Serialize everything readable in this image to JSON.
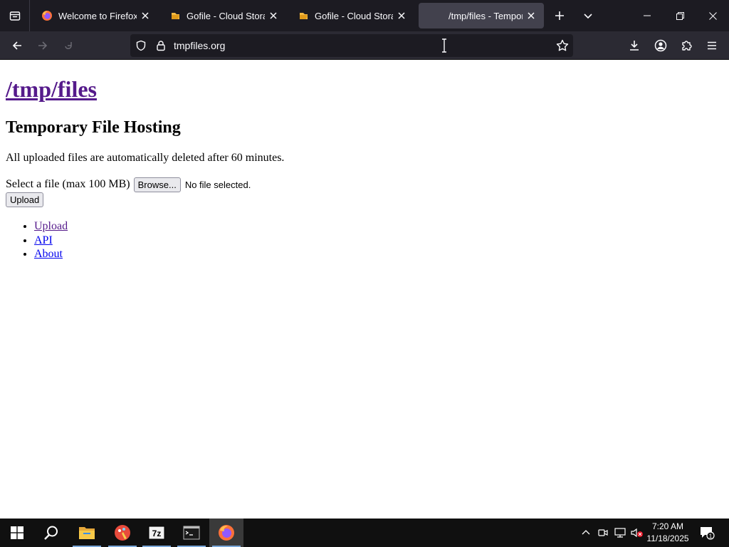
{
  "browser": {
    "tabs": [
      {
        "title": "Welcome to Firefox",
        "icon": "firefox-icon",
        "active": false
      },
      {
        "title": "Gofile - Cloud Storage Made Simple",
        "icon": "gofile-icon",
        "active": false
      },
      {
        "title": "Gofile - Cloud Storage Made Simple",
        "icon": "gofile-icon",
        "active": false
      },
      {
        "title": "/tmp/files - Temporary File Hosting",
        "icon": "",
        "active": true
      }
    ],
    "url": "tmpfiles.org"
  },
  "page": {
    "site_title": "/tmp/files",
    "heading": "Temporary File Hosting",
    "notice": "All uploaded files are automatically deleted after 60 minutes.",
    "file_label": "Select a file (max 100 MB)",
    "browse_label": "Browse...",
    "file_status": "No file selected.",
    "upload_label": "Upload",
    "nav_links": [
      {
        "label": "Upload",
        "visited": true
      },
      {
        "label": "API",
        "visited": false
      },
      {
        "label": "About",
        "visited": false
      }
    ]
  },
  "taskbar": {
    "apps": [
      "start-icon",
      "search-icon",
      "file-explorer-icon",
      "paint-app-icon",
      "7zip-icon",
      "terminal-icon",
      "firefox-icon"
    ],
    "time": "7:20 AM",
    "date": "11/18/2025"
  },
  "colors": {
    "tabbar_bg": "#1c1b22",
    "navbar_bg": "#2b2a33",
    "active_tab_bg": "#42414d",
    "visited_link": "#551a8b",
    "link": "#0000ee",
    "taskbar_bg": "#101010"
  }
}
